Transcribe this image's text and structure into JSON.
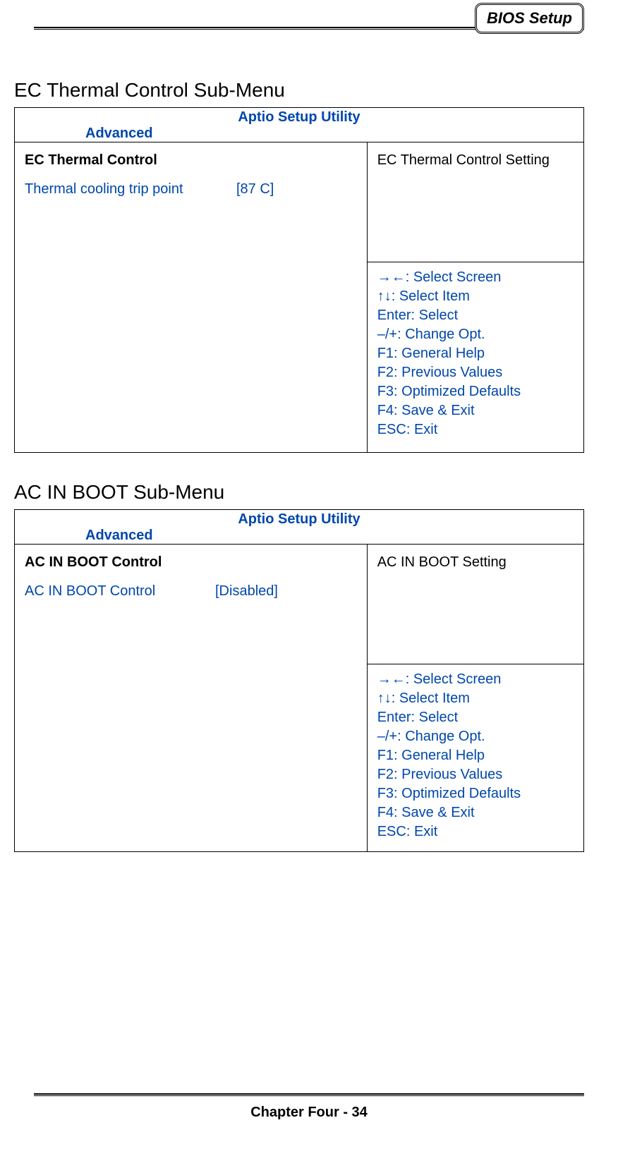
{
  "header": {
    "badge": "BIOS Setup"
  },
  "sections": [
    {
      "title": "EC Thermal Control Sub-Menu",
      "utility_title": "Aptio Setup Utility",
      "tab": "Advanced",
      "group_title": "EC Thermal Control",
      "setting_label": "Thermal cooling trip point",
      "setting_value": "[87 C]",
      "description": "EC Thermal Control Setting"
    },
    {
      "title": "AC IN BOOT Sub-Menu",
      "utility_title": "Aptio Setup Utility",
      "tab": "Advanced",
      "group_title": "AC IN BOOT Control",
      "setting_label": "AC IN BOOT Control",
      "setting_value": "[Disabled]",
      "description": "AC IN BOOT Setting"
    }
  ],
  "help": {
    "l1": "→←: Select Screen",
    "l2": "↑↓: Select Item",
    "l3": "Enter: Select",
    "l4": "–/+: Change Opt.",
    "l5": "F1: General Help",
    "l6": "F2: Previous Values",
    "l7": "F3: Optimized Defaults",
    "l8": "F4: Save & Exit",
    "l9": "ESC: Exit"
  },
  "footer": {
    "text": "Chapter Four - 34"
  }
}
